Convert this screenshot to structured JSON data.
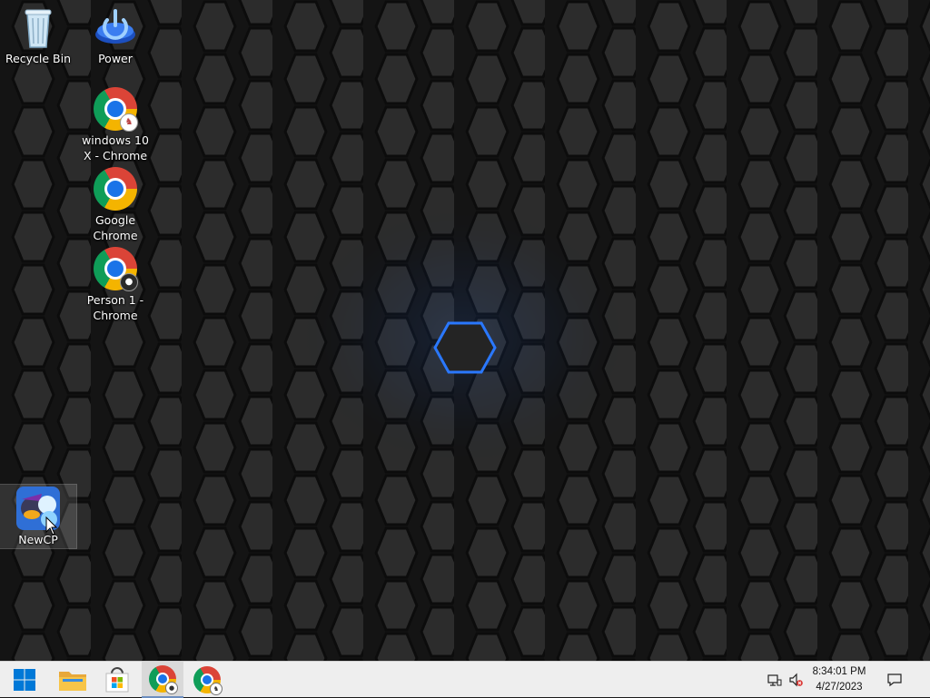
{
  "desktop": {
    "icons": [
      {
        "id": "recycle-bin",
        "label": "Recycle Bin"
      },
      {
        "id": "power",
        "label": "Power"
      },
      {
        "id": "chrome-win10x",
        "label": "windows 10 X - Chrome"
      },
      {
        "id": "google-chrome",
        "label": "Google Chrome"
      },
      {
        "id": "chrome-person1",
        "label": "Person 1 - Chrome"
      },
      {
        "id": "newcp",
        "label": "NewCP"
      }
    ]
  },
  "taskbar": {
    "items": [
      "start-icon",
      "file-explorer-icon",
      "microsoft-store-icon",
      "chrome-person-icon",
      "chrome-win10x-icon"
    ],
    "clock": {
      "time": "8:34:01 PM",
      "date": "4/27/2023"
    }
  },
  "colors": {
    "wallpaper_base": "#1e1e1e",
    "hex_glow": "#1f6fff",
    "taskbar_bg": "#eeeeee",
    "start_blue": "#0078d7"
  }
}
